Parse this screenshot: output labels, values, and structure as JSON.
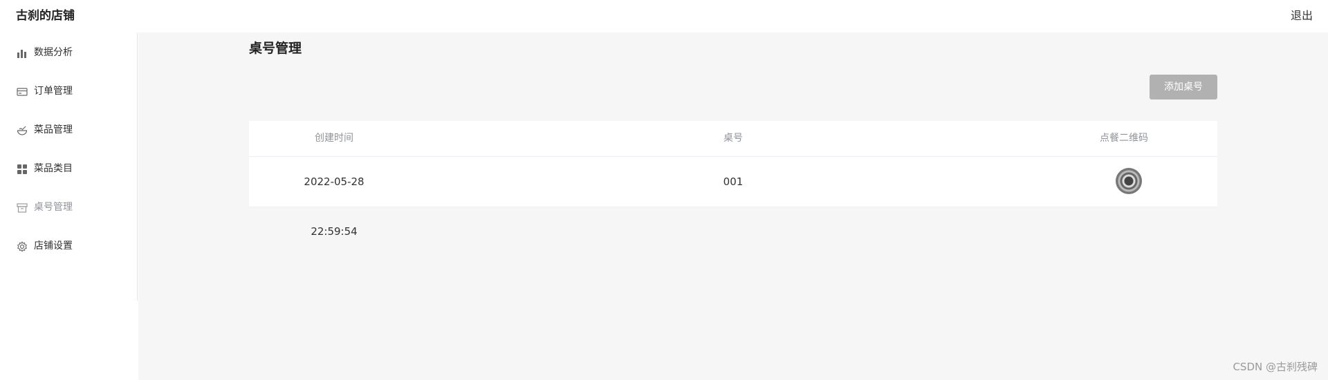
{
  "header": {
    "shop_name": "古刹的店铺",
    "logout_label": "退出"
  },
  "sidebar": {
    "items": [
      {
        "label": "数据分析",
        "icon": "bar-chart-icon"
      },
      {
        "label": "订单管理",
        "icon": "credit-card-icon"
      },
      {
        "label": "菜品管理",
        "icon": "bowl-icon"
      },
      {
        "label": "菜品类目",
        "icon": "grid-icon"
      },
      {
        "label": "桌号管理",
        "icon": "box-icon",
        "active": true
      },
      {
        "label": "店铺设置",
        "icon": "gear-icon"
      }
    ]
  },
  "main": {
    "title": "桌号管理",
    "add_button_label": "添加桌号",
    "table": {
      "columns": [
        "创建时间",
        "桌号",
        "点餐二维码"
      ],
      "rows": [
        {
          "created_at": "2022-05-28 22:59:54",
          "table_no": "001",
          "qr": "qr-code-thumbnail"
        }
      ]
    }
  },
  "watermark": "CSDN @古刹残碑",
  "colors": {
    "main_bg": "#f6f6f6",
    "button_bg": "#b1b1b1",
    "header_text_muted": "#909399"
  }
}
